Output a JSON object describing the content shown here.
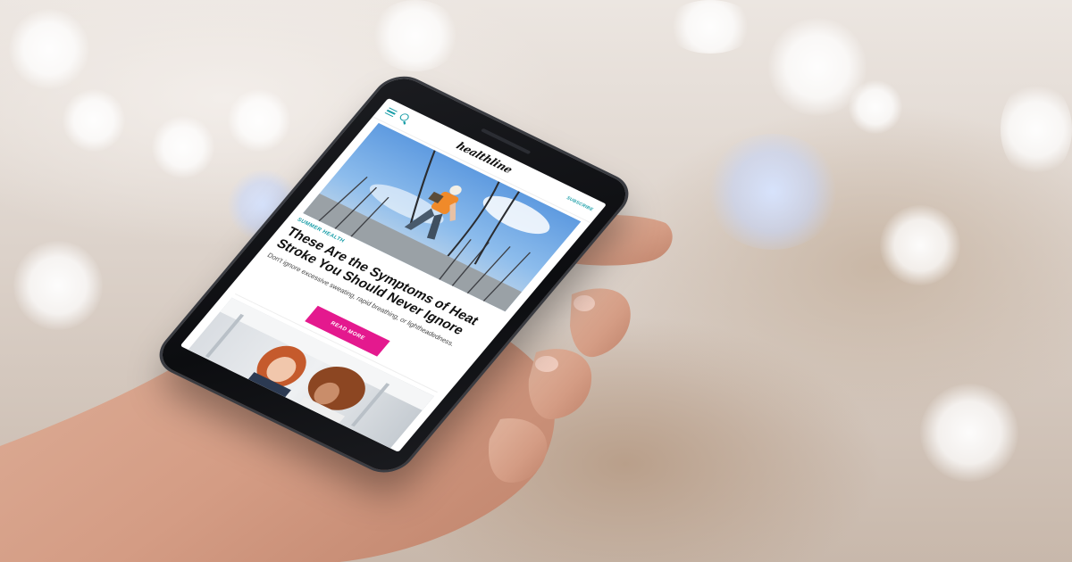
{
  "app": {
    "logo_text": "healthline",
    "subscribe_label": "SUBSCRIBE"
  },
  "article": {
    "section_label": "SUMMER HEALTH",
    "headline": "These Are the Symptoms of Heat Stroke You Should Never Ignore",
    "dek": "Don't ignore excessive sweating, rapid breathing, or lightheadedness.",
    "cta_label": "READ MORE"
  },
  "icons": [
    "menu-icon",
    "search-icon"
  ],
  "colors": {
    "accent": "#1a9ea8",
    "button": "#e4198e",
    "phone_body": "#0c0d10"
  }
}
